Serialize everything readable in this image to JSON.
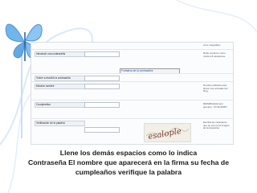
{
  "slide": {
    "caption_lines": [
      "Llene los demás espacios como lo indica",
      "Contraseña   El nombre que aparecerá en la firma su fecha de",
      "cumpleaños    verifique la palabra"
    ]
  },
  "form": {
    "top_note": "error ortográfico.",
    "rows": [
      {
        "label": "Introducir una contraseña",
        "help": "Debe contener como mínimo 8 caracteres."
      },
      {
        "label": "Volver a escribir la contraseña",
        "help": ""
      },
      {
        "label": "Mostrar nombre",
        "help": "Nombre utilizado para firmar sus entradas del blog."
      },
      {
        "label": "Cumpleaños",
        "help": "DD/MM/AAAA (por ejemplo, \"27/11/2005\")"
      },
      {
        "label": "Verificación de la palabra",
        "help": "Escriba los caracteres que se ven en la imagen de la izquierda."
      }
    ],
    "strength_label": "Fortaleza de la contraseña:",
    "captcha_text": "esalople"
  },
  "colors": {
    "accent_blue": "#2c7fd0",
    "butterfly": "#5aa9e8",
    "swirl": "#dbe9f6"
  }
}
